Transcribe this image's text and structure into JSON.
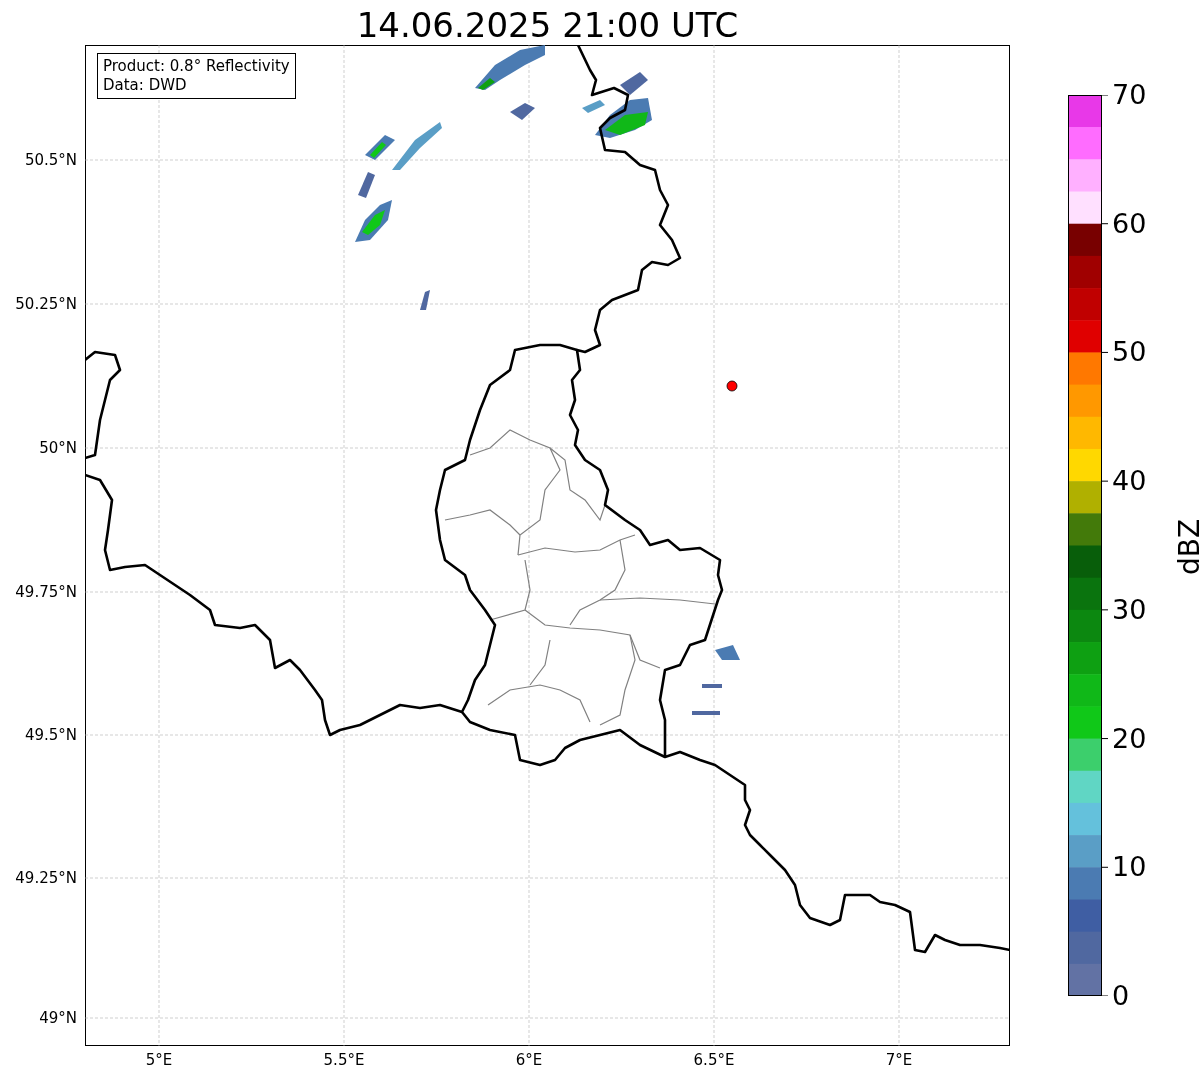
{
  "title": "14.06.2025 21:00 UTC",
  "legend": [
    "Product: 0.8° Reflectivity",
    "Data: DWD"
  ],
  "x_ticks": [
    "5°E",
    "5.5°E",
    "6°E",
    "6.5°E",
    "7°E"
  ],
  "y_ticks": [
    "50.5°N",
    "50.25°N",
    "50°N",
    "49.75°N",
    "49.5°N",
    "49.25°N",
    "49°N"
  ],
  "colorbar": {
    "label": "dBZ",
    "ticks": [
      "70",
      "60",
      "50",
      "40",
      "30",
      "20",
      "10",
      "0"
    ],
    "bands": [
      {
        "color": "#e838e8"
      },
      {
        "color": "#ff6cff"
      },
      {
        "color": "#ffb0ff"
      },
      {
        "color": "#ffe0ff"
      },
      {
        "color": "#780000"
      },
      {
        "color": "#a00000"
      },
      {
        "color": "#c00000"
      },
      {
        "color": "#e00000"
      },
      {
        "color": "#ff7800"
      },
      {
        "color": "#ff9800"
      },
      {
        "color": "#ffb800"
      },
      {
        "color": "#ffd800"
      },
      {
        "color": "#b0b000"
      },
      {
        "color": "#437a0a"
      },
      {
        "color": "#085e0a"
      },
      {
        "color": "#0a740e"
      },
      {
        "color": "#0c8810"
      },
      {
        "color": "#0ea012"
      },
      {
        "color": "#10b818"
      },
      {
        "color": "#10c818"
      },
      {
        "color": "#3ccf6c"
      },
      {
        "color": "#60d6c4"
      },
      {
        "color": "#64c1dc"
      },
      {
        "color": "#5a9ec6"
      },
      {
        "color": "#4b7bb2"
      },
      {
        "color": "#3f5ea3"
      },
      {
        "color": "#5068a0"
      },
      {
        "color": "#6272a4"
      }
    ]
  }
}
